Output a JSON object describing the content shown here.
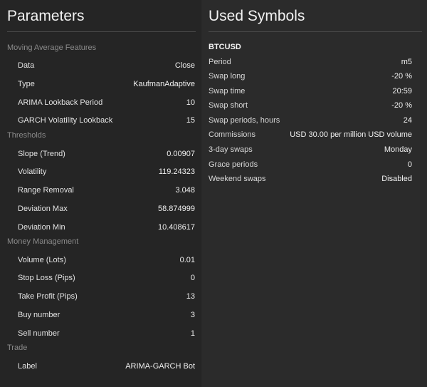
{
  "parameters": {
    "title": "Parameters",
    "sections": [
      {
        "header": "Moving Average Features",
        "rows": [
          {
            "label": "Data",
            "value": "Close"
          },
          {
            "label": "Type",
            "value": "KaufmanAdaptive"
          },
          {
            "label": "ARIMA Lookback Period",
            "value": "10"
          },
          {
            "label": "GARCH Volatility Lookback",
            "value": "15"
          }
        ]
      },
      {
        "header": "Thresholds",
        "rows": [
          {
            "label": "Slope (Trend)",
            "value": "0.00907"
          },
          {
            "label": "Volatility",
            "value": "119.24323"
          },
          {
            "label": "Range Removal",
            "value": "3.048"
          },
          {
            "label": "Deviation Max",
            "value": "58.874999"
          },
          {
            "label": "Deviation Min",
            "value": "10.408617"
          }
        ]
      },
      {
        "header": "Money Management",
        "rows": [
          {
            "label": "Volume (Lots)",
            "value": "0.01"
          },
          {
            "label": "Stop Loss (Pips)",
            "value": "0"
          },
          {
            "label": "Take Profit (Pips)",
            "value": "13"
          },
          {
            "label": "Buy number",
            "value": "3"
          },
          {
            "label": "Sell number",
            "value": "1"
          }
        ]
      },
      {
        "header": "Trade",
        "rows": [
          {
            "label": "Label",
            "value": "ARIMA-GARCH Bot"
          }
        ]
      }
    ]
  },
  "used_symbols": {
    "title": "Used Symbols",
    "symbol": "BTCUSD",
    "rows": [
      {
        "label": "Period",
        "value": "m5"
      },
      {
        "label": "Swap long",
        "value": "-20 %"
      },
      {
        "label": "Swap time",
        "value": "20:59"
      },
      {
        "label": "Swap short",
        "value": "-20 %"
      },
      {
        "label": "Swap periods, hours",
        "value": "24"
      },
      {
        "label": "Commissions",
        "value": "USD 30.00 per million USD volume"
      },
      {
        "label": "3-day swaps",
        "value": "Monday"
      },
      {
        "label": "Grace periods",
        "value": "0"
      },
      {
        "label": "Weekend swaps",
        "value": "Disabled"
      }
    ]
  }
}
